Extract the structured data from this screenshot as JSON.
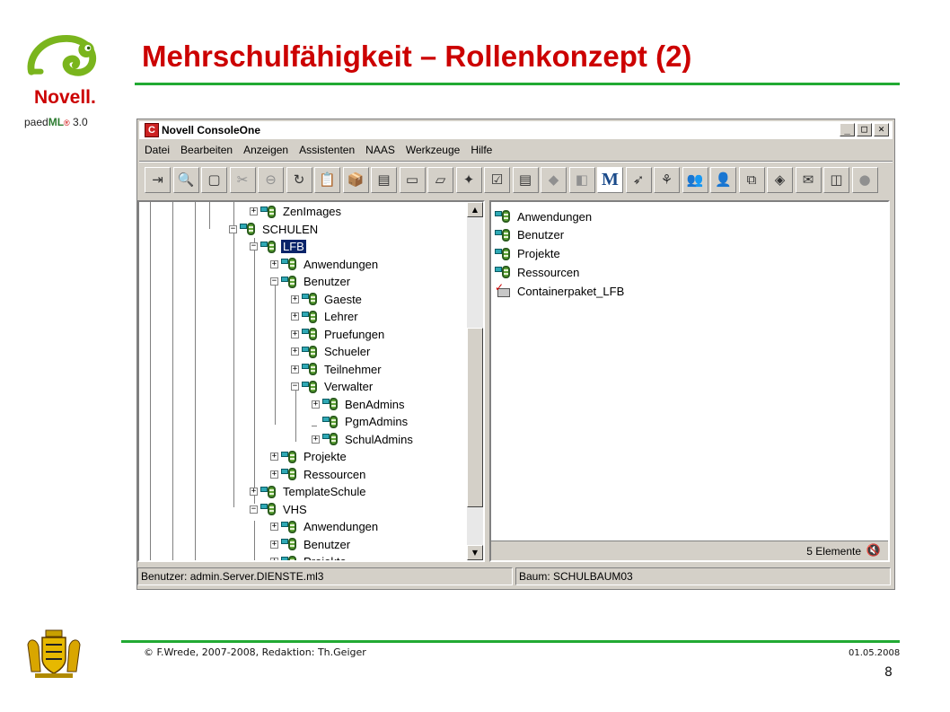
{
  "slide": {
    "title": "Mehrschulfähigkeit – Rollenkonzept (2)",
    "brand_name": "Novell",
    "brand_dot": ".",
    "sub_brand_prefix": "paed",
    "sub_brand_ml": "ML",
    "sub_brand_reg": "®",
    "sub_brand_version": " 3.0",
    "footer_copyright": "© F.Wrede, 2007-2008, Redaktion: Th.Geiger",
    "footer_date": "01.05.2008",
    "page_number": "8",
    "accent_color": "#cc0000",
    "rule_color": "#22aa33"
  },
  "window": {
    "title": "Novell ConsoleOne",
    "app_icon_letter": "C",
    "controls": {
      "minimize": "_",
      "maximize": "□",
      "close": "✕"
    },
    "menu": [
      "Datei",
      "Bearbeiten",
      "Anzeigen",
      "Assistenten",
      "NAAS",
      "Werkzeuge",
      "Hilfe"
    ],
    "toolbar_icons": [
      {
        "name": "exit-icon",
        "glyph": "⇥",
        "disabled": false
      },
      {
        "name": "find-icon",
        "glyph": "🔍",
        "disabled": false
      },
      {
        "name": "search-window-icon",
        "glyph": "▢",
        "disabled": false
      },
      {
        "name": "cut-icon",
        "glyph": "✂",
        "disabled": true
      },
      {
        "name": "stop-icon",
        "glyph": "⊖",
        "disabled": true
      },
      {
        "name": "refresh-icon",
        "glyph": "↻",
        "disabled": false
      },
      {
        "name": "properties-icon",
        "glyph": "📋",
        "disabled": false
      },
      {
        "name": "package-icon",
        "glyph": "📦",
        "disabled": false
      },
      {
        "name": "tray-red-icon",
        "glyph": "▤",
        "disabled": false
      },
      {
        "name": "tray-icon",
        "glyph": "▭",
        "disabled": false
      },
      {
        "name": "tray-arrow-icon",
        "glyph": "▱",
        "disabled": false
      },
      {
        "name": "network-icon",
        "glyph": "✦",
        "disabled": false
      },
      {
        "name": "checklist-icon",
        "glyph": "☑",
        "disabled": false
      },
      {
        "name": "document-icon",
        "glyph": "▤",
        "disabled": false
      },
      {
        "name": "folder-disabled-icon",
        "glyph": "◆",
        "disabled": true
      },
      {
        "name": "copy-disabled-icon",
        "glyph": "◧",
        "disabled": true
      },
      {
        "name": "m-letter-icon",
        "glyph": "M",
        "disabled": false,
        "m": true
      },
      {
        "name": "tree-green-icon",
        "glyph": "➶",
        "disabled": false
      },
      {
        "name": "tree-bare-icon",
        "glyph": "⚘",
        "disabled": false
      },
      {
        "name": "users-group-icon",
        "glyph": "👥",
        "disabled": false
      },
      {
        "name": "user-icon",
        "glyph": "👤",
        "disabled": false
      },
      {
        "name": "hierarchy-icon",
        "glyph": "⧉",
        "disabled": false
      },
      {
        "name": "cube-icon",
        "glyph": "◈",
        "disabled": false
      },
      {
        "name": "envelope-icon",
        "glyph": "✉",
        "disabled": false
      },
      {
        "name": "window-icon",
        "glyph": "◫",
        "disabled": false
      },
      {
        "name": "people-disabled-icon",
        "glyph": "●",
        "disabled": true
      }
    ]
  },
  "tree": {
    "rows": [
      {
        "label": "ZenImages",
        "expander": "+",
        "level": 4
      },
      {
        "label": "SCHULEN",
        "expander": "−",
        "level": 3
      },
      {
        "label": "LFB",
        "expander": "−",
        "level": 4,
        "selected": true
      },
      {
        "label": "Anwendungen",
        "expander": "+",
        "level": 5
      },
      {
        "label": "Benutzer",
        "expander": "−",
        "level": 5
      },
      {
        "label": "Gaeste",
        "expander": "+",
        "level": 6
      },
      {
        "label": "Lehrer",
        "expander": "+",
        "level": 6
      },
      {
        "label": "Pruefungen",
        "expander": "+",
        "level": 6
      },
      {
        "label": "Schueler",
        "expander": "+",
        "level": 6
      },
      {
        "label": "Teilnehmer",
        "expander": "+",
        "level": 6
      },
      {
        "label": "Verwalter",
        "expander": "−",
        "level": 6
      },
      {
        "label": "BenAdmins",
        "expander": "+",
        "level": 7
      },
      {
        "label": "PgmAdmins",
        "expander": "",
        "level": 7
      },
      {
        "label": "SchulAdmins",
        "expander": "+",
        "level": 7
      },
      {
        "label": "Projekte",
        "expander": "+",
        "level": 5
      },
      {
        "label": "Ressourcen",
        "expander": "+",
        "level": 5
      },
      {
        "label": "TemplateSchule",
        "expander": "+",
        "level": 4
      },
      {
        "label": "VHS",
        "expander": "−",
        "level": 4
      },
      {
        "label": "Anwendungen",
        "expander": "+",
        "level": 5
      },
      {
        "label": "Benutzer",
        "expander": "+",
        "level": 5
      },
      {
        "label": "Projekte",
        "expander": "+",
        "level": 5
      }
    ],
    "scroll_up": "▲",
    "scroll_down": "▼"
  },
  "list": {
    "items": [
      {
        "label": "Anwendungen",
        "type": "container"
      },
      {
        "label": "Benutzer",
        "type": "container"
      },
      {
        "label": "Projekte",
        "type": "container"
      },
      {
        "label": "Ressourcen",
        "type": "container"
      },
      {
        "label": "Containerpaket_LFB",
        "type": "package"
      }
    ],
    "count_text": "5 Elemente",
    "count_icon": "🔇"
  },
  "statusbar": {
    "user": "Benutzer: admin.Server.DIENSTE.ml3",
    "tree": "Baum: SCHULBAUM03"
  }
}
